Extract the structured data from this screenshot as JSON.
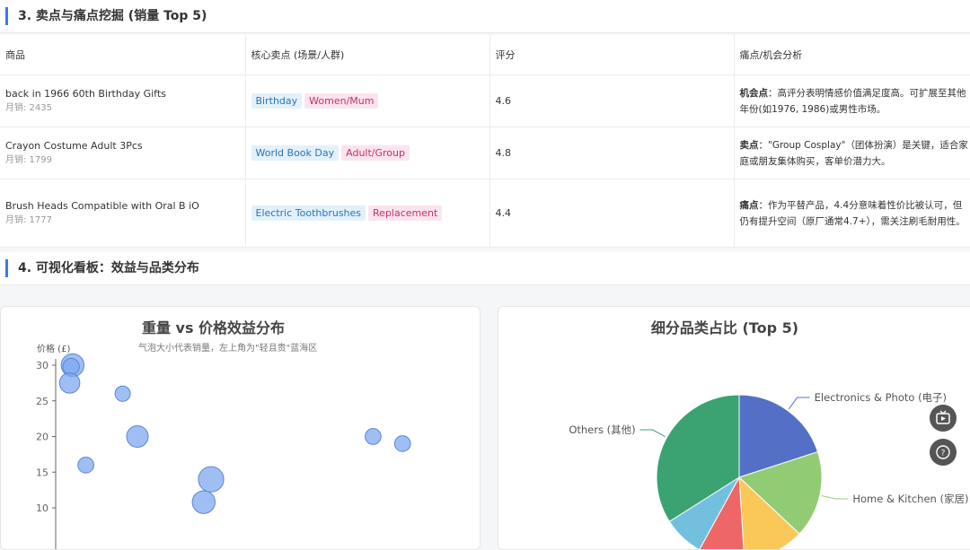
{
  "section3": {
    "title": "3. 卖点与痛点挖掘 (销量 Top 5)"
  },
  "table": {
    "headers": [
      "商品",
      "核心卖点 (场景/人群)",
      "评分",
      "痛点/机会分析"
    ],
    "rows": [
      {
        "name": "back in 1966 60th Birthday Gifts",
        "sales": "月销: 2435",
        "tags": [
          "Birthday",
          "Women/Mum"
        ],
        "rating": "4.6",
        "analysis_label": "机会点",
        "analysis_text": "：高评分表明情感价值满足度高。可扩展至其他年份(如1976, 1986)或男性市场。"
      },
      {
        "name": "Crayon Costume Adult 3Pcs",
        "sales": "月销: 1799",
        "tags": [
          "World Book Day",
          "Adult/Group"
        ],
        "rating": "4.8",
        "analysis_label": "卖点",
        "analysis_text": "：\"Group Cosplay\"（团体扮演）是关键，适合家庭或朋友集体购买，客单价潜力大。"
      },
      {
        "name": "Brush Heads Compatible with Oral B iO",
        "sales": "月销: 1777",
        "tags": [
          "Electric Toothbrushes",
          "Replacement"
        ],
        "rating": "4.4",
        "analysis_label": "痛点",
        "analysis_text": "：作为平替产品，4.4分意味着性价比被认可，但仍有提升空间（原厂通常4.7+），需关注刷毛耐用性。"
      }
    ]
  },
  "section4": {
    "title": "4. 可视化看板：效益与品类分布"
  },
  "scatter_card": {
    "title": "重量 vs 价格效益分布",
    "subtitle": "气泡大小代表销量，左上角为\"轻且贵\"蓝海区",
    "ylabel": "价格 (£)"
  },
  "pie_card": {
    "title": "细分品类占比 (Top 5)"
  },
  "chart_data": [
    {
      "type": "scatter",
      "title": "重量 vs 价格效益分布",
      "subtitle": "气泡大小代表销量，左上角为\"轻且贵\"蓝海区",
      "ylabel": "价格 (£)",
      "xlabel": "",
      "yticks": [
        10,
        15,
        20,
        25,
        30
      ],
      "ylim": [
        10,
        30
      ],
      "points_note": "x values unlabeled in visible area",
      "points": [
        {
          "x": 0.12,
          "y": 30,
          "size": 2.2
        },
        {
          "x": 0.1,
          "y": 29.8,
          "size": 1.2
        },
        {
          "x": 0.08,
          "y": 27.5,
          "size": 1.8
        },
        {
          "x": 0.8,
          "y": 26,
          "size": 1.0
        },
        {
          "x": 0.3,
          "y": 16,
          "size": 1.1
        },
        {
          "x": 1.0,
          "y": 20,
          "size": 2.0
        },
        {
          "x": 2.0,
          "y": 14,
          "size": 2.6
        },
        {
          "x": 1.9,
          "y": 10.8,
          "size": 2.2
        },
        {
          "x": 4.2,
          "y": 20,
          "size": 1.1
        },
        {
          "x": 4.6,
          "y": 19,
          "size": 1.1
        }
      ],
      "color": "#7fa8f0"
    },
    {
      "type": "pie",
      "title": "细分品类占比 (Top 5)",
      "slices": [
        {
          "label": "Electronics & Photo (电子)",
          "value": 20,
          "color": "#5470c6"
        },
        {
          "label": "Home & Kitchen (家居)",
          "value": 17,
          "color": "#91cc75"
        },
        {
          "label": "",
          "value": 12,
          "color": "#fac858"
        },
        {
          "label": "",
          "value": 9,
          "color": "#ee6666"
        },
        {
          "label": "",
          "value": 8,
          "color": "#73c0de"
        },
        {
          "label": "Others (其他)",
          "value": 34,
          "color": "#3ba272"
        }
      ]
    }
  ],
  "icons": {
    "tv": "tv-icon",
    "help": "question-icon"
  }
}
